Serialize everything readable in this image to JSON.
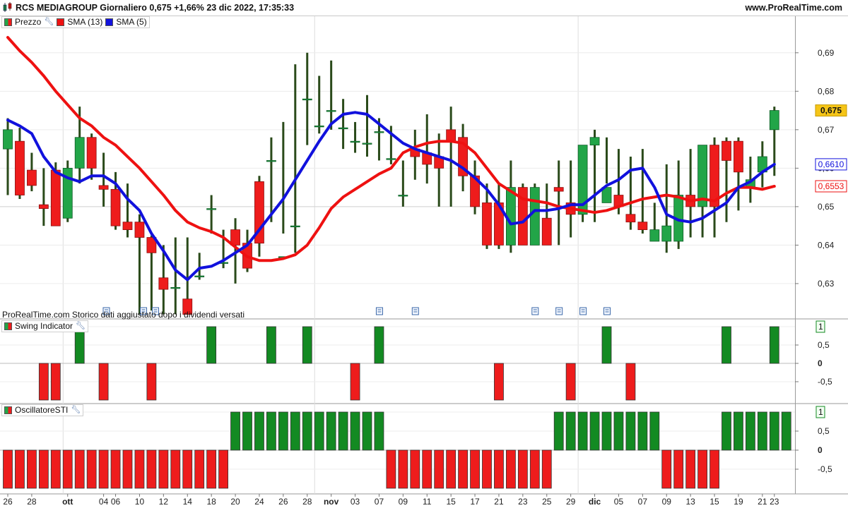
{
  "header": {
    "title": "RCS MEDIAGROUP Giornaliero 0,675 +1,66% 23 dic 2022, 17:35:33",
    "site": "www.ProRealTime.com"
  },
  "legend_price": {
    "price_label": "Prezzo",
    "sma13_label": "SMA (13)",
    "sma5_label": "SMA (5)"
  },
  "legend_swing": {
    "label": "Swing Indicator"
  },
  "legend_sti": {
    "label": "OscillatoreSTI"
  },
  "footnote": "ProRealTime.com  Storico dati aggiustato dopo i dividendi versati",
  "colors": {
    "up": "#22a548",
    "down": "#ee1c1c",
    "sma13": "#ee1111",
    "sma5": "#1111dd",
    "osc_up": "#138a22",
    "osc_down": "#ee1c1c",
    "last_price_bg": "#f5c518"
  },
  "chart_data": [
    {
      "type": "candlestick",
      "title": "RCS MEDIAGROUP Giornaliero",
      "x": [
        "26 set",
        "27 set",
        "28 set",
        "29 set",
        "30 set",
        "03 ott",
        "04 ott",
        "05 ott",
        "06 ott",
        "07 ott",
        "10 ott",
        "11 ott",
        "12 ott",
        "13 ott",
        "14 ott",
        "17 ott",
        "18 ott",
        "19 ott",
        "20 ott",
        "21 ott",
        "24 ott",
        "25 ott",
        "26 ott",
        "27 ott",
        "28 ott",
        "31 ott",
        "01 nov",
        "02 nov",
        "03 nov",
        "04 nov",
        "07 nov",
        "08 nov",
        "09 nov",
        "10 nov",
        "11 nov",
        "14 nov",
        "15 nov",
        "16 nov",
        "17 nov",
        "18 nov",
        "21 nov",
        "22 nov",
        "23 nov",
        "24 nov",
        "25 nov",
        "28 nov",
        "29 nov",
        "30 nov",
        "01 dic",
        "02 dic",
        "05 dic",
        "06 dic",
        "07 dic",
        "08 dic",
        "09 dic",
        "12 dic",
        "13 dic",
        "14 dic",
        "15 dic",
        "16 dic",
        "19 dic",
        "20 dic",
        "21 dic",
        "22 dic",
        "23 dic"
      ],
      "x_tick_labels": [
        "26",
        "28",
        "ott",
        "04",
        "06",
        "10",
        "12",
        "14",
        "18",
        "20",
        "24",
        "26",
        "28",
        "nov",
        "03",
        "07",
        "09",
        "11",
        "15",
        "17",
        "21",
        "23",
        "25",
        "29",
        "dic",
        "05",
        "07",
        "09",
        "13",
        "15",
        "19",
        "21",
        "23"
      ],
      "open": [
        0.665,
        0.667,
        0.6595,
        0.6505,
        0.6595,
        0.647,
        0.66,
        0.668,
        0.6555,
        0.6545,
        0.646,
        0.646,
        0.642,
        0.6315,
        0.629,
        0.626,
        0.632,
        0.6495,
        0.6355,
        0.644,
        0.6405,
        0.6565,
        0.662,
        0.637,
        0.645,
        0.678,
        0.671,
        0.675,
        0.6705,
        0.667,
        0.6665,
        0.6695,
        0.6625,
        0.653,
        0.665,
        0.664,
        0.663,
        0.67,
        0.668,
        0.658,
        0.651,
        0.651,
        0.64,
        0.655,
        0.64,
        0.647,
        0.655,
        0.651,
        0.648,
        0.666,
        0.651,
        0.653,
        0.648,
        0.646,
        0.641,
        0.641,
        0.641,
        0.653,
        0.65,
        0.666,
        0.667,
        0.667,
        0.655,
        0.659,
        0.67
      ],
      "close": [
        0.67,
        0.653,
        0.6555,
        0.6495,
        0.645,
        0.66,
        0.668,
        0.66,
        0.6545,
        0.645,
        0.644,
        0.642,
        0.638,
        0.6285,
        0.629,
        0.622,
        0.632,
        0.6495,
        0.6355,
        0.64,
        0.634,
        0.6405,
        0.662,
        0.637,
        0.645,
        0.678,
        0.671,
        0.675,
        0.6705,
        0.667,
        0.6665,
        0.6695,
        0.6625,
        0.653,
        0.663,
        0.661,
        0.66,
        0.667,
        0.658,
        0.65,
        0.64,
        0.64,
        0.655,
        0.64,
        0.655,
        0.64,
        0.654,
        0.648,
        0.666,
        0.668,
        0.655,
        0.65,
        0.646,
        0.644,
        0.644,
        0.645,
        0.653,
        0.65,
        0.666,
        0.65,
        0.662,
        0.659,
        0.657,
        0.663,
        0.675
      ],
      "high": [
        0.673,
        0.6705,
        0.664,
        0.66,
        0.6615,
        0.662,
        0.676,
        0.669,
        0.664,
        0.659,
        0.656,
        0.648,
        0.6425,
        0.64,
        0.642,
        0.642,
        0.638,
        0.653,
        0.644,
        0.647,
        0.644,
        0.658,
        0.668,
        0.672,
        0.687,
        0.69,
        0.684,
        0.688,
        0.678,
        0.672,
        0.679,
        0.673,
        0.671,
        0.662,
        0.67,
        0.674,
        0.669,
        0.676,
        0.6715,
        0.662,
        0.656,
        0.656,
        0.662,
        0.656,
        0.656,
        0.656,
        0.662,
        0.662,
        0.658,
        0.67,
        0.668,
        0.665,
        0.663,
        0.665,
        0.651,
        0.661,
        0.662,
        0.665,
        0.666,
        0.668,
        0.668,
        0.668,
        0.663,
        0.667,
        0.676
      ],
      "low": [
        0.653,
        0.652,
        0.654,
        0.645,
        0.645,
        0.646,
        0.656,
        0.657,
        0.65,
        0.644,
        0.642,
        0.622,
        0.623,
        0.622,
        0.622,
        0.622,
        0.631,
        0.643,
        0.634,
        0.63,
        0.633,
        0.637,
        0.646,
        0.643,
        0.638,
        0.666,
        0.669,
        0.67,
        0.665,
        0.664,
        0.663,
        0.662,
        0.661,
        0.65,
        0.657,
        0.656,
        0.65,
        0.65,
        0.654,
        0.648,
        0.639,
        0.639,
        0.638,
        0.64,
        0.64,
        0.64,
        0.64,
        0.642,
        0.646,
        0.646,
        0.656,
        0.648,
        0.644,
        0.643,
        0.641,
        0.638,
        0.639,
        0.642,
        0.642,
        0.642,
        0.646,
        0.649,
        0.651,
        0.655,
        0.658
      ],
      "sma13": [
        0.694,
        0.6905,
        0.6875,
        0.684,
        0.68,
        0.6765,
        0.673,
        0.671,
        0.668,
        0.666,
        0.663,
        0.66,
        0.6565,
        0.653,
        0.649,
        0.646,
        0.6445,
        0.6435,
        0.642,
        0.6395,
        0.637,
        0.636,
        0.636,
        0.6365,
        0.6375,
        0.64,
        0.6445,
        0.6495,
        0.6525,
        0.6545,
        0.6565,
        0.6585,
        0.66,
        0.664,
        0.6655,
        0.6665,
        0.667,
        0.667,
        0.6665,
        0.664,
        0.66,
        0.656,
        0.654,
        0.652,
        0.6515,
        0.651,
        0.65,
        0.6495,
        0.649,
        0.6485,
        0.649,
        0.65,
        0.651,
        0.652,
        0.6525,
        0.653,
        0.6525,
        0.6515,
        0.652,
        0.6515,
        0.6535,
        0.655,
        0.655,
        0.6545,
        0.6553
      ],
      "sma5": [
        0.6725,
        0.671,
        0.669,
        0.663,
        0.659,
        0.6575,
        0.6565,
        0.658,
        0.658,
        0.656,
        0.652,
        0.649,
        0.643,
        0.6385,
        0.6335,
        0.631,
        0.634,
        0.6345,
        0.636,
        0.638,
        0.64,
        0.644,
        0.648,
        0.652,
        0.657,
        0.662,
        0.667,
        0.6715,
        0.674,
        0.6745,
        0.674,
        0.6715,
        0.669,
        0.6665,
        0.665,
        0.664,
        0.663,
        0.662,
        0.66,
        0.6575,
        0.6545,
        0.6505,
        0.6455,
        0.646,
        0.649,
        0.649,
        0.6495,
        0.6505,
        0.6505,
        0.653,
        0.6555,
        0.657,
        0.6595,
        0.66,
        0.655,
        0.648,
        0.6465,
        0.646,
        0.647,
        0.649,
        0.651,
        0.655,
        0.6565,
        0.659,
        0.661
      ],
      "ylim": [
        0.621,
        0.6995
      ],
      "y_ticks": [
        "0,63",
        "0,64",
        "0,65",
        "0,66",
        "0,67",
        "0,68",
        "0,69"
      ],
      "last_price_label": "0,675",
      "sma5_last_label": "0,6610",
      "sma13_last_label": "0,6553",
      "series": [
        {
          "name": "Prezzo"
        },
        {
          "name": "SMA (13)"
        },
        {
          "name": "SMA (5)"
        }
      ]
    },
    {
      "type": "bar",
      "title": "Swing Indicator",
      "values": [
        0,
        0,
        0,
        -1,
        -1,
        0,
        1,
        0,
        -1,
        0,
        0,
        0,
        -1,
        0,
        0,
        0,
        0,
        1,
        0,
        0,
        0,
        0,
        1,
        0,
        0,
        1,
        0,
        0,
        0,
        -1,
        0,
        1,
        0,
        0,
        0,
        0,
        0,
        0,
        0,
        0,
        0,
        -1,
        0,
        0,
        0,
        0,
        0,
        -1,
        0,
        0,
        1,
        0,
        -1,
        0,
        0,
        0,
        0,
        0,
        0,
        0,
        1,
        0,
        0,
        0,
        1
      ],
      "ylim": [
        -1,
        1
      ],
      "y_ticks": [
        "-0,5",
        "0",
        "0,5",
        "1"
      ],
      "last_value_label": "1"
    },
    {
      "type": "bar",
      "title": "OscillatoreSTI",
      "values": [
        -1,
        -1,
        -1,
        -1,
        -1,
        -1,
        -1,
        -1,
        -1,
        -1,
        -1,
        -1,
        -1,
        -1,
        -1,
        -1,
        -1,
        -1,
        -1,
        1,
        1,
        1,
        1,
        1,
        1,
        1,
        1,
        1,
        1,
        1,
        1,
        1,
        -1,
        -1,
        -1,
        -1,
        -1,
        -1,
        -1,
        -1,
        -1,
        -1,
        -1,
        -1,
        -1,
        -1,
        1,
        1,
        1,
        1,
        1,
        1,
        1,
        1,
        1,
        -1,
        -1,
        -1,
        -1,
        -1,
        1,
        1,
        1,
        1,
        1,
        1
      ],
      "ylim": [
        -1,
        1
      ],
      "y_ticks": [
        "-0,5",
        "0",
        "0,5",
        "1"
      ],
      "last_value_label": "1"
    }
  ]
}
